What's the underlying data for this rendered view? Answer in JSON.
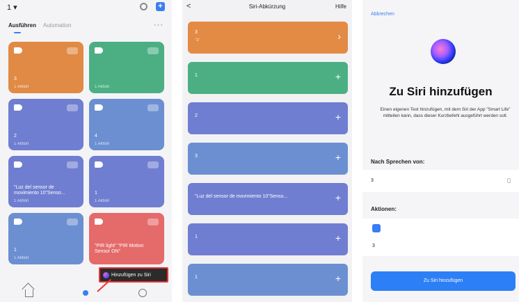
{
  "screen1": {
    "top_left": "1",
    "tabs": [
      "Ausführen",
      "Automation"
    ],
    "more": "···",
    "cards": [
      {
        "name": "3",
        "sub": "1 Aktion",
        "color": "orange"
      },
      {
        "name": "",
        "sub": "1 Aktion",
        "color": "green"
      },
      {
        "name": "2",
        "sub": "1 Aktion",
        "color": "blue"
      },
      {
        "name": "4",
        "sub": "1 Aktion",
        "color": "steel"
      },
      {
        "name": "\"Luz del sensor de movimiento 10\"Senso...",
        "sub": "1 Aktion",
        "color": "blue"
      },
      {
        "name": "1",
        "sub": "1 Aktion",
        "color": "blue"
      },
      {
        "name": "1",
        "sub": "1 Aktion",
        "color": "steel"
      },
      {
        "name": "\"PIR light\" \"PIR Motion Sensor ON\"",
        "sub": "",
        "color": "red"
      }
    ],
    "siri_button": "Hinzufügen zu Siri"
  },
  "screen2": {
    "back": "<",
    "title": "Siri-Abkürzung",
    "help": "Hilfe",
    "rows": [
      {
        "label": "3",
        "sub": "\"3\"",
        "action": "›",
        "color": "#e38a45"
      },
      {
        "label": "1",
        "sub": "",
        "action": "+",
        "color": "#4caf84"
      },
      {
        "label": "2",
        "sub": "",
        "action": "+",
        "color": "#6f7ed0"
      },
      {
        "label": "3",
        "sub": "",
        "action": "+",
        "color": "#6c8fd2"
      },
      {
        "label": "\"Luz del sensor de movimiento 10\"Senso...",
        "sub": "",
        "action": "+",
        "color": "#6f7ed0"
      },
      {
        "label": "1",
        "sub": "",
        "action": "+",
        "color": "#6f7ed0"
      },
      {
        "label": "1",
        "sub": "",
        "action": "+",
        "color": "#6c8fd2"
      }
    ]
  },
  "screen3": {
    "cancel": "Abbrechen",
    "title": "Zu Siri hinzufügen",
    "description": "Einen eigenen Text hinzufügen, mit dem Siri der App \"Smart Life\" mitteilen kann, dass dieser Kurzbefehl ausgeführt werden soll.",
    "after_speaking_label": "Nach Sprechen von:",
    "phrase": "3",
    "actions_label": "Aktionen:",
    "action_name": "3",
    "add_button": "Zu Siri hinzufügen"
  }
}
